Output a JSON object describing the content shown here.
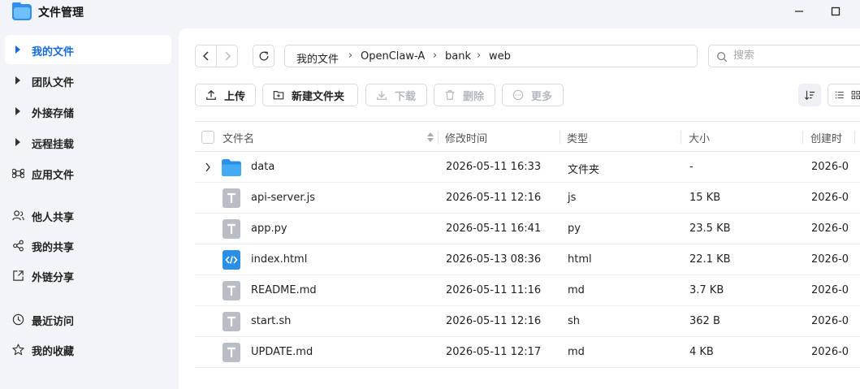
{
  "app": {
    "title": "文件管理"
  },
  "sidebar": {
    "items": [
      {
        "label": "我的文件",
        "icon": "caret-right-icon"
      },
      {
        "label": "团队文件",
        "icon": "caret-right-icon"
      },
      {
        "label": "外接存储",
        "icon": "caret-right-icon"
      },
      {
        "label": "远程挂载",
        "icon": "caret-right-icon"
      },
      {
        "label": "应用文件",
        "icon": "command-icon"
      },
      {
        "label": "他人共享",
        "icon": "users-icon"
      },
      {
        "label": "我的共享",
        "icon": "share-icon"
      },
      {
        "label": "外链分享",
        "icon": "external-link-icon"
      },
      {
        "label": "最近访问",
        "icon": "clock-icon"
      },
      {
        "label": "我的收藏",
        "icon": "star-icon"
      }
    ]
  },
  "breadcrumb": [
    "我的文件",
    "OpenClaw-A",
    "bank",
    "web"
  ],
  "search": {
    "placeholder": "搜索"
  },
  "toolbar": {
    "upload": "上传",
    "new_folder": "新建文件夹",
    "download": "下载",
    "delete": "删除",
    "more": "更多"
  },
  "table": {
    "columns": [
      "文件名",
      "修改时间",
      "类型",
      "大小",
      "创建时"
    ],
    "rows": [
      {
        "name": "data",
        "modified": "2026-05-11 16:33",
        "type": "文件夹",
        "size": "-",
        "created": "2026-0",
        "icon": "folder-icon"
      },
      {
        "name": "api-server.js",
        "modified": "2026-05-11 12:16",
        "type": "js",
        "size": "15 KB",
        "created": "2026-0",
        "icon": "text-file-icon"
      },
      {
        "name": "app.py",
        "modified": "2026-05-11 16:41",
        "type": "py",
        "size": "23.5 KB",
        "created": "2026-0",
        "icon": "text-file-icon"
      },
      {
        "name": "index.html",
        "modified": "2026-05-13 08:36",
        "type": "html",
        "size": "22.1 KB",
        "created": "2026-0",
        "icon": "code-file-icon"
      },
      {
        "name": "README.md",
        "modified": "2026-05-11 11:16",
        "type": "md",
        "size": "3.7 KB",
        "created": "2026-0",
        "icon": "text-file-icon"
      },
      {
        "name": "start.sh",
        "modified": "2026-05-11 12:16",
        "type": "sh",
        "size": "362 B",
        "created": "2026-0",
        "icon": "text-file-icon"
      },
      {
        "name": "UPDATE.md",
        "modified": "2026-05-11 12:17",
        "type": "md",
        "size": "4 KB",
        "created": "2026-0",
        "icon": "text-file-icon"
      }
    ]
  },
  "colors": {
    "accent": "#1769e0",
    "folder": "#3aa0f2",
    "file_gray": "#b9bec6",
    "code_blue": "#2b8fe6"
  }
}
